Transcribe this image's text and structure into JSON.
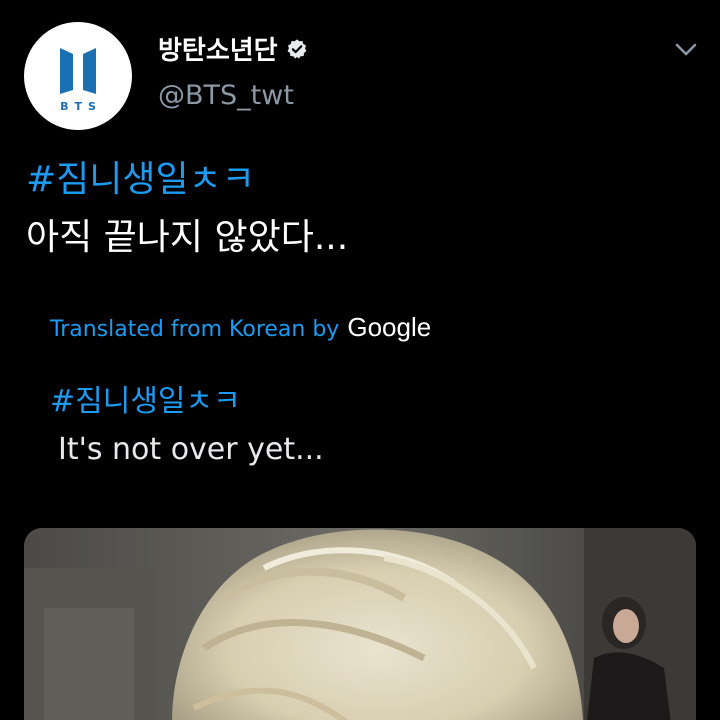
{
  "account": {
    "display_name": "방탄소년단",
    "handle": "@BTS_twt",
    "avatar_logo_text": "BTS",
    "verified_icon": "verified-badge-icon"
  },
  "menu": {
    "icon": "chevron-down-icon"
  },
  "tweet": {
    "hashtag": "#짐니생일ㅊㅋ",
    "text": "아직 끝나지 않았다..."
  },
  "translation": {
    "label": "Translated from Korean by",
    "provider": "Google",
    "hashtag": "#짐니생일ㅊㅋ",
    "text": "It's not over yet..."
  },
  "media": {
    "type": "photo"
  },
  "colors": {
    "background": "#000000",
    "link": "#1d9bf0",
    "secondary_text": "#8b98a5",
    "brand_blue": "#1b6fb3"
  }
}
